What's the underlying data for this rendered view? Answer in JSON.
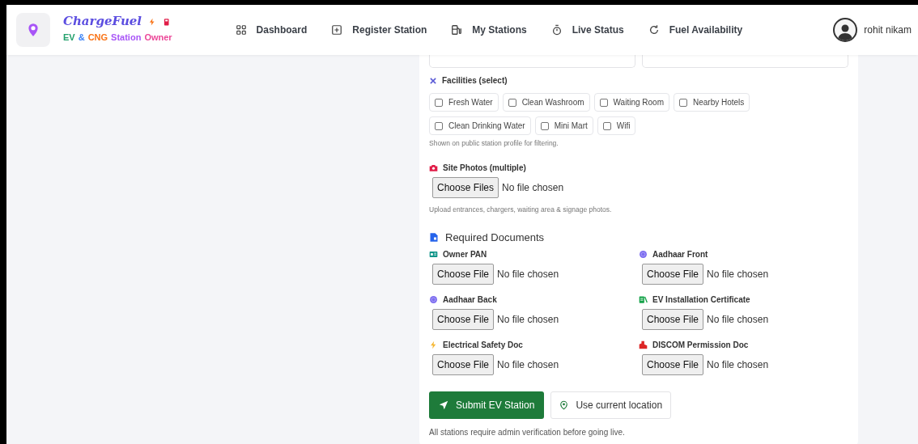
{
  "brand": {
    "name": "ChargeFuel",
    "subtitle": [
      {
        "text": "EV",
        "color": "#22a06b"
      },
      {
        "text": "&",
        "color": "#3b82f6"
      },
      {
        "text": "CNG",
        "color": "#f97316"
      },
      {
        "text": "Station",
        "color": "#a855f7"
      },
      {
        "text": "Owner",
        "color": "#ec4899"
      }
    ]
  },
  "nav": [
    {
      "label": "Dashboard"
    },
    {
      "label": "Register Station"
    },
    {
      "label": "My Stations"
    },
    {
      "label": "Live Status"
    },
    {
      "label": "Fuel Availability"
    }
  ],
  "user": {
    "name": "rohit nikam"
  },
  "facilities": {
    "label": "Facilities (select)",
    "options": [
      {
        "label": "Fresh Water",
        "checked": false
      },
      {
        "label": "Clean Washroom",
        "checked": false
      },
      {
        "label": "Waiting Room",
        "checked": false
      },
      {
        "label": "Nearby Hotels",
        "checked": false
      },
      {
        "label": "Clean Drinking Water",
        "checked": false
      },
      {
        "label": "Mini Mart",
        "checked": false
      },
      {
        "label": "Wifi",
        "checked": false
      }
    ],
    "help": "Shown on public station profile for filtering."
  },
  "site_photos": {
    "label": "Site Photos (multiple)",
    "button": "Choose Files",
    "status": "No file chosen",
    "help": "Upload entrances, chargers, waiting area & signage photos."
  },
  "documents": {
    "title": "Required Documents",
    "items": [
      {
        "label": "Owner PAN",
        "color": "#0d9488",
        "button": "Choose File",
        "status": "No file chosen"
      },
      {
        "label": "Aadhaar Front",
        "color": "#7c6cf0",
        "button": "Choose File",
        "status": "No file chosen"
      },
      {
        "label": "Aadhaar Back",
        "color": "#7c6cf0",
        "button": "Choose File",
        "status": "No file chosen"
      },
      {
        "label": "EV Installation Certificate",
        "color": "#16a34a",
        "button": "Choose File",
        "status": "No file chosen"
      },
      {
        "label": "Electrical Safety Doc",
        "color": "#f5b731",
        "button": "Choose File",
        "status": "No file chosen"
      },
      {
        "label": "DISCOM Permission Doc",
        "color": "#dc2626",
        "button": "Choose File",
        "status": "No file chosen"
      }
    ]
  },
  "actions": {
    "submit": "Submit EV Station",
    "location": "Use current location",
    "note": "All stations require admin verification before going live."
  }
}
